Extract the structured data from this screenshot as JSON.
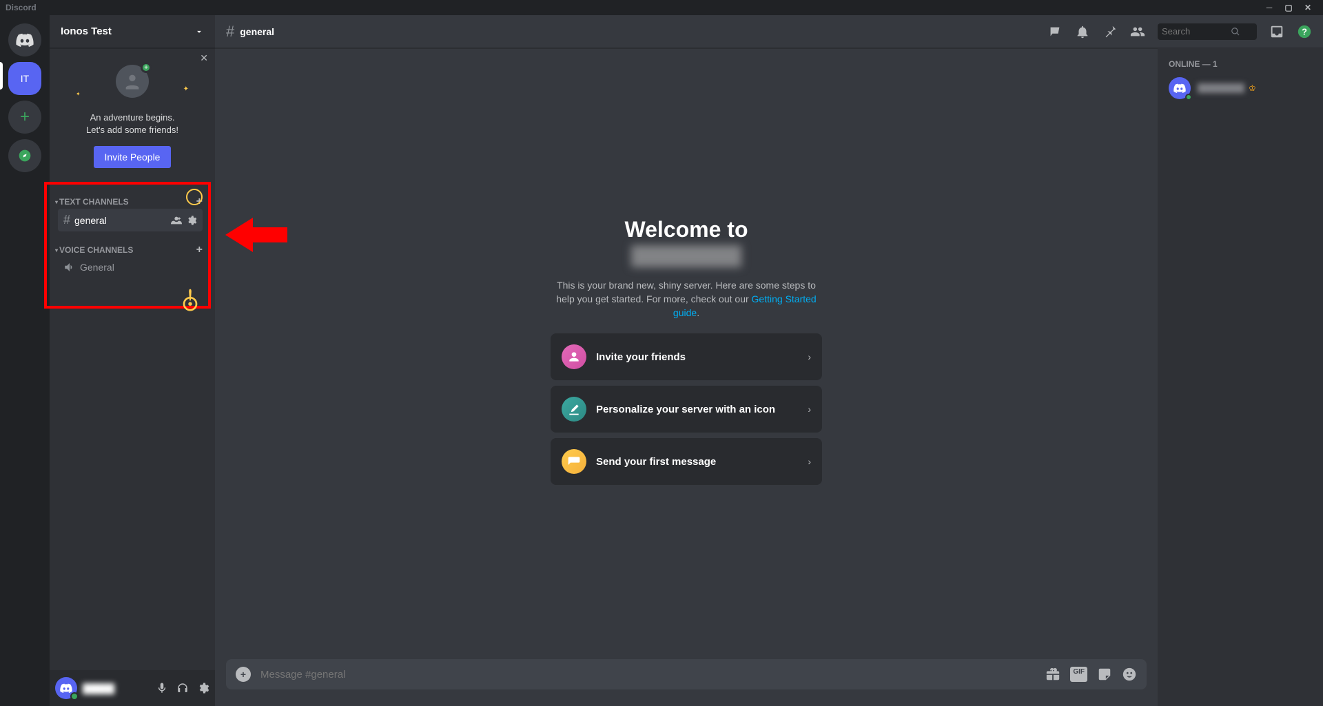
{
  "titlebar": {
    "app_name": "Discord"
  },
  "server": {
    "name": "Ionos Test",
    "abbrev": "IT"
  },
  "invite_card": {
    "line1": "An adventure begins.",
    "line2": "Let's add some friends!",
    "button": "Invite People"
  },
  "categories": {
    "text_label": "TEXT CHANNELS",
    "voice_label": "VOICE CHANNELS"
  },
  "channels": {
    "text": [
      {
        "name": "general"
      }
    ],
    "voice": [
      {
        "name": "General"
      }
    ]
  },
  "header": {
    "channel_name": "general",
    "search_placeholder": "Search"
  },
  "welcome": {
    "title": "Welcome to",
    "subtitle_before": "This is your brand new, shiny server. Here are some steps to help you get started. For more, check out our ",
    "subtitle_link": "Getting Started guide",
    "subtitle_after": "."
  },
  "action_cards": [
    {
      "label": "Invite your friends"
    },
    {
      "label": "Personalize your server with an icon"
    },
    {
      "label": "Send your first message"
    }
  ],
  "chat_input": {
    "placeholder": "Message #general"
  },
  "members": {
    "header": "ONLINE — 1"
  }
}
